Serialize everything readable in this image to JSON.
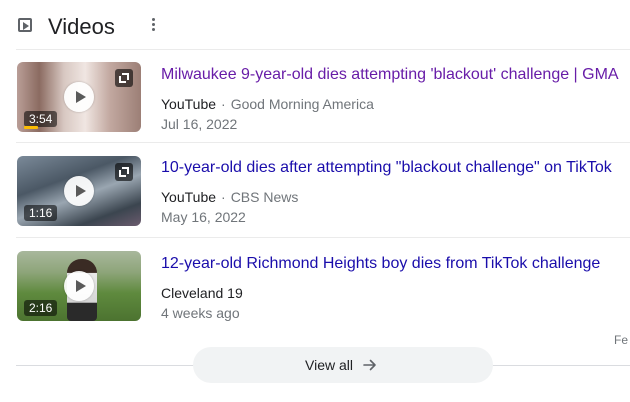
{
  "header": {
    "title": "Videos",
    "icon": "play-box-icon",
    "menu_icon": "more-vert-icon"
  },
  "videos": [
    {
      "title": "Milwaukee 9-year-old dies attempting 'blackout' challenge | GMA",
      "platform": "YouTube",
      "channel": "Good Morning America",
      "date": "Jul 16, 2022",
      "duration": "3:54",
      "visited": true,
      "thumb_colors": [
        "#c9b3ad",
        "#8f6f66",
        "#e8d9d4"
      ]
    },
    {
      "title": "10-year-old dies after attempting \"blackout challenge\" on TikTok",
      "platform": "YouTube",
      "channel": "CBS News",
      "date": "May 16, 2022",
      "duration": "1:16",
      "visited": false,
      "thumb_colors": [
        "#53606d",
        "#8a96a3",
        "#2f3a44"
      ]
    },
    {
      "title": "12-year-old Richmond Heights boy dies from TikTok challenge",
      "platform": "Cleveland 19",
      "channel": "",
      "date": "4 weeks ago",
      "duration": "2:16",
      "visited": false,
      "thumb_colors": [
        "#6e8f4c",
        "#a9b59a",
        "#3e3a36"
      ]
    }
  ],
  "footer": {
    "feedback_label": "Fe",
    "view_all_label": "View all",
    "view_all_icon": "arrow-right-icon"
  },
  "colors": {
    "visited_link": "#681da8",
    "link": "#1a0dab",
    "secondary_text": "#70757a",
    "button_bg": "#f1f3f4"
  }
}
